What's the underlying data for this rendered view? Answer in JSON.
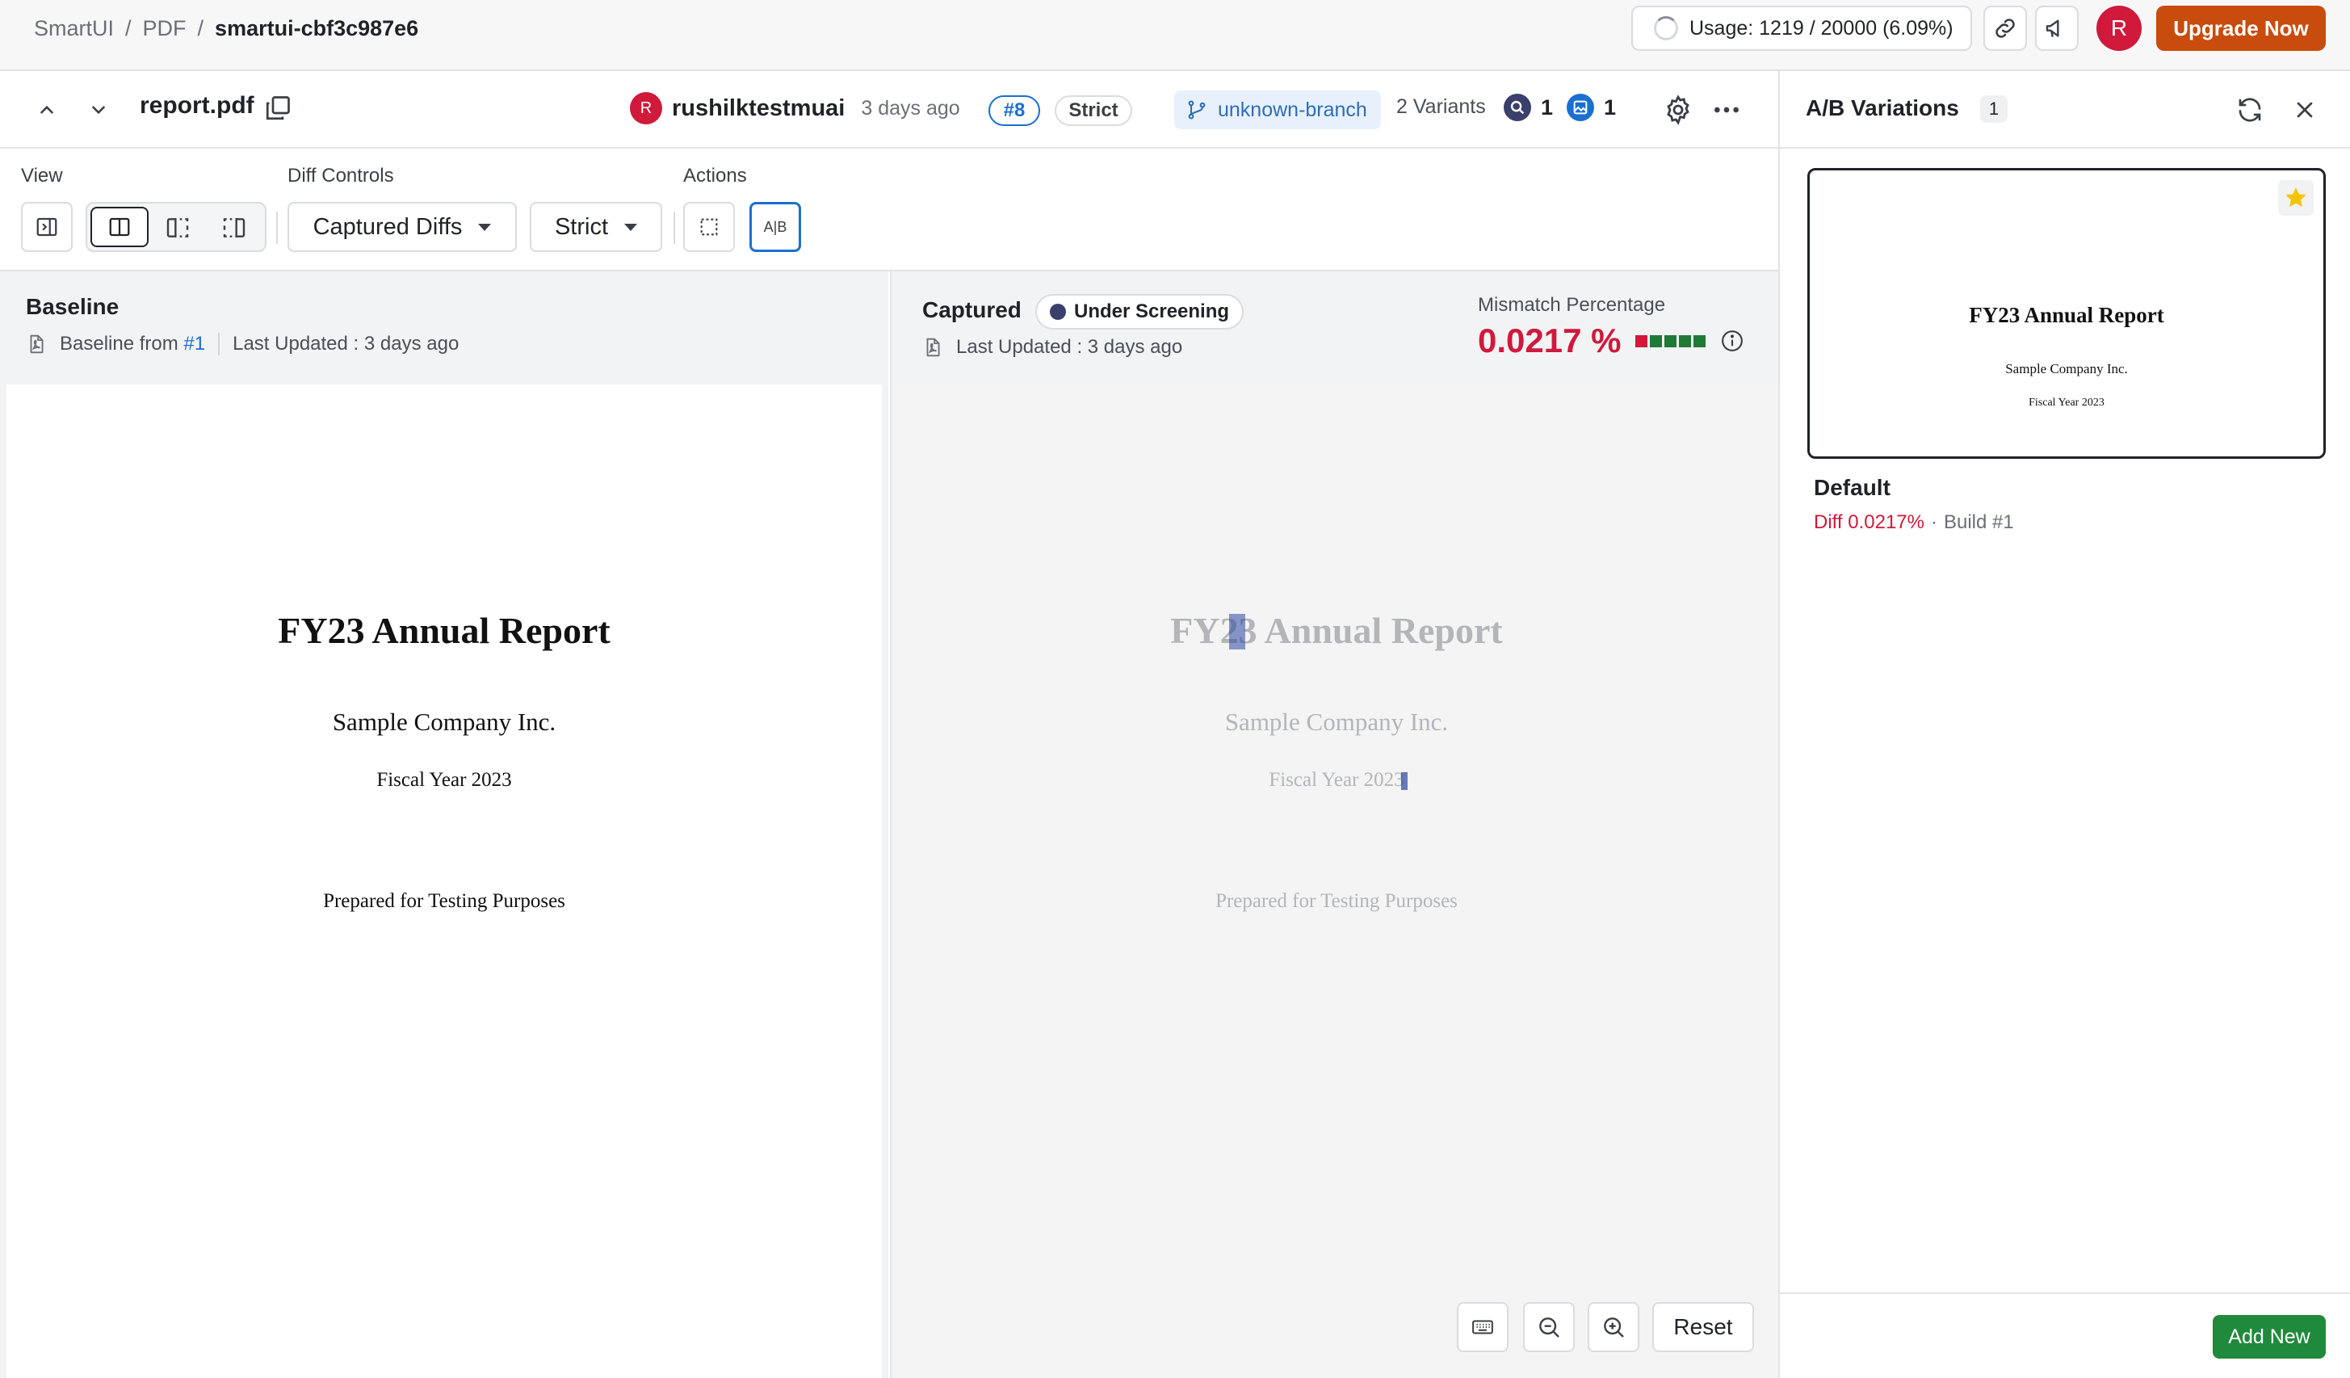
{
  "breadcrumb": {
    "root": "SmartUI",
    "section": "PDF",
    "separator": "/",
    "current": "smartui-cbf3c987e6"
  },
  "topbar": {
    "usage": "Usage: 1219 / 20000 (6.09%)",
    "avatar_initial": "R",
    "upgrade_label": "Upgrade Now"
  },
  "header": {
    "file_name": "report.pdf",
    "author_initial": "R",
    "author": "rushilktestmuai",
    "time": "3 days ago",
    "build": "#8",
    "mode": "Strict",
    "branch": "unknown-branch",
    "variants": "2 Variants",
    "count_a": "1",
    "count_b": "1"
  },
  "toolbar": {
    "view_label": "View",
    "diff_controls_label": "Diff Controls",
    "actions_label": "Actions",
    "diff_dropdown": "Captured Diffs",
    "mode_dropdown": "Strict",
    "ab_label": "A|B"
  },
  "baseline": {
    "title": "Baseline",
    "source_prefix": "Baseline from",
    "source_link": "#1",
    "updated": "Last Updated : 3 days ago"
  },
  "captured": {
    "title": "Captured",
    "status": "Under Screening",
    "updated": "Last Updated : 3 days ago",
    "mismatch_label": "Mismatch Percentage",
    "mismatch_value": "0.0217 %"
  },
  "document": {
    "title": "FY23 Annual Report",
    "company": "Sample Company Inc.",
    "fiscal": "Fiscal Year 2023",
    "prepared": "Prepared for Testing Purposes"
  },
  "zoom": {
    "reset_label": "Reset"
  },
  "ab_panel": {
    "title": "A/B Variations",
    "count": "1",
    "variant_name": "Default",
    "variant_diff": "Diff 0.0217%",
    "variant_separator": "·",
    "variant_build": "Build #1",
    "add_new_label": "Add New"
  },
  "colors": {
    "accent_blue": "#1b6fd1",
    "danger_red": "#d0193b",
    "upgrade_orange": "#c84c0c",
    "success_green": "#1f8a3b"
  }
}
